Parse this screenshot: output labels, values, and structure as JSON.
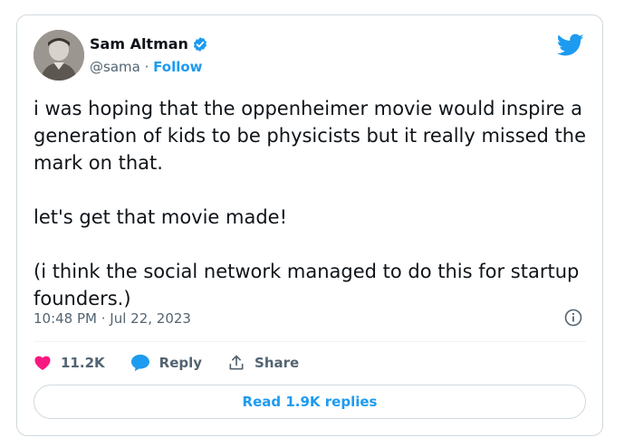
{
  "author": {
    "name": "Sam Altman",
    "handle": "@sama",
    "separator": " · ",
    "follow_label": "Follow"
  },
  "tweet": {
    "text": "i was hoping that the oppenheimer movie would inspire a generation of kids to be physicists but it really missed the mark on that.\n\nlet's get that movie made!\n\n(i think the social network managed to do this for startup founders.)",
    "timestamp": "10:48 PM · Jul 22, 2023"
  },
  "actions": {
    "likes": "11.2K",
    "reply_label": "Reply",
    "share_label": "Share"
  },
  "read_replies_label": "Read 1.9K replies",
  "colors": {
    "accent": "#1d9bf0",
    "like": "#f91880",
    "text": "#0f1419",
    "muted": "#536471"
  },
  "icons": [
    "avatar",
    "verified-badge-icon",
    "twitter-bird-icon",
    "info-icon",
    "heart-icon",
    "reply-bubble-icon",
    "share-icon"
  ]
}
